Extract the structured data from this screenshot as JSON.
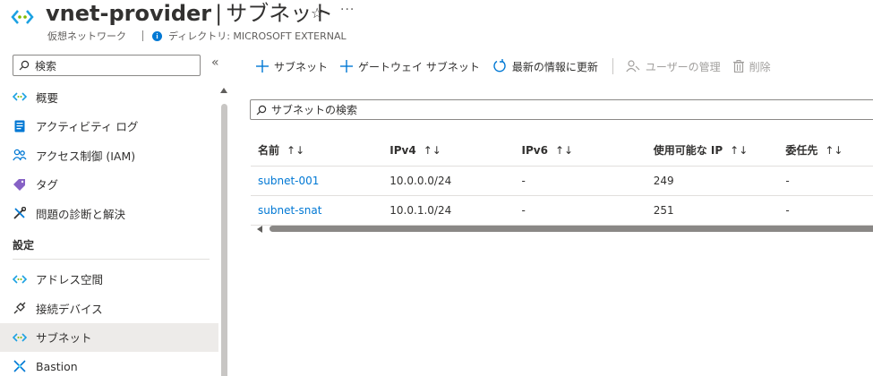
{
  "header": {
    "resource_name": "vnet-provider",
    "separator": "|",
    "page_title": "サブネット",
    "resource_type": "仮想ネットワーク",
    "directory": "ディレクトリ: MICROSOFT EXTERNAL"
  },
  "sidebar": {
    "search_label": "検索",
    "collapse_glyph": "«",
    "items_top": [
      {
        "label": "概要",
        "icon": "vnet-icon"
      },
      {
        "label": "アクティビティ ログ",
        "icon": "activity-log-icon"
      },
      {
        "label": "アクセス制御 (IAM)",
        "icon": "people-icon"
      },
      {
        "label": "タグ",
        "icon": "tag-icon"
      },
      {
        "label": "問題の診断と解決",
        "icon": "wrench-icon"
      }
    ],
    "section_settings": "設定",
    "items_settings": [
      {
        "label": "アドレス空間",
        "icon": "vnet-icon"
      },
      {
        "label": "接続デバイス",
        "icon": "plug-icon"
      },
      {
        "label": "サブネット",
        "icon": "vnet-icon",
        "active": true
      },
      {
        "label": "Bastion",
        "icon": "bastion-icon"
      }
    ]
  },
  "toolbar": {
    "add_subnet": "サブネット",
    "add_gateway_subnet": "ゲートウェイ サブネット",
    "refresh": "最新の情報に更新",
    "manage_users": "ユーザーの管理",
    "delete": "削除"
  },
  "filter": {
    "placeholder": "サブネットの検索"
  },
  "table": {
    "columns": [
      "名前",
      "IPv4",
      "IPv6",
      "使用可能な IP",
      "委任先"
    ],
    "sort_glyph": "↑↓",
    "rows": [
      {
        "name": "subnet-001",
        "ipv4": "10.0.0.0/24",
        "ipv6": "-",
        "available_ips": "249",
        "delegated_to": "-"
      },
      {
        "name": "subnet-snat",
        "ipv4": "10.0.1.0/24",
        "ipv6": "-",
        "available_ips": "251",
        "delegated_to": "-"
      }
    ]
  },
  "colors": {
    "accent": "#0078d4",
    "link": "#0078d4",
    "active_bg": "#edebe9"
  }
}
